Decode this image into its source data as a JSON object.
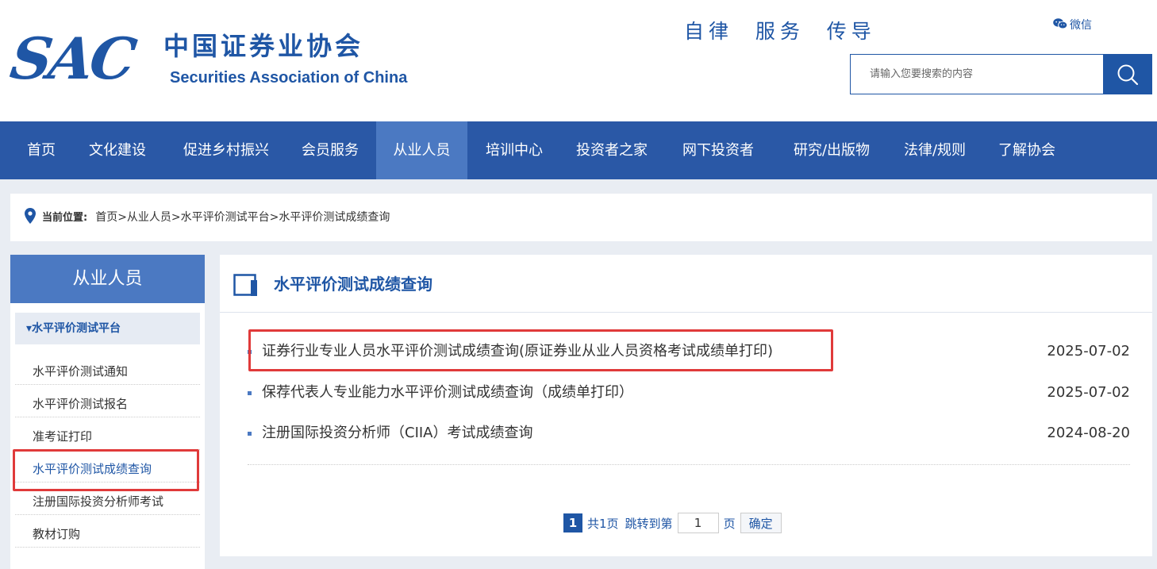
{
  "header": {
    "logo_mark": "SAC",
    "logo_cn": "中国证券业协会",
    "logo_en": "Securities Association of China",
    "slogan": "自律  服务  传导",
    "wechat_label": "微信",
    "search_placeholder": "请输入您要搜索的内容"
  },
  "nav": {
    "items": [
      {
        "label": "首页"
      },
      {
        "label": "文化建设"
      },
      {
        "label": "促进乡村振兴"
      },
      {
        "label": "会员服务"
      },
      {
        "label": "从业人员"
      },
      {
        "label": "培训中心"
      },
      {
        "label": "投资者之家"
      },
      {
        "label": "网下投资者"
      },
      {
        "label": "研究/出版物"
      },
      {
        "label": "法律/规则"
      },
      {
        "label": "了解协会"
      }
    ],
    "active": "从业人员"
  },
  "breadcrumb": {
    "label": "当前位置:",
    "path": "首页>从业人员>水平评价测试平台>水平评价测试成绩查询"
  },
  "sidebar": {
    "title": "从业人员",
    "group": "▾水平评价测试平台",
    "items": [
      {
        "label": "水平评价测试通知"
      },
      {
        "label": "水平评价测试报名"
      },
      {
        "label": "准考证打印"
      },
      {
        "label": "水平评价测试成绩查询"
      },
      {
        "label": "注册国际投资分析师考试"
      },
      {
        "label": "教材订购"
      }
    ]
  },
  "main": {
    "title": "水平评价测试成绩查询",
    "rows": [
      {
        "title": "证券行业专业人员水平评价测试成绩查询(原证券业从业人员资格考试成绩单打印)",
        "date": "2025-07-02"
      },
      {
        "title": "保荐代表人专业能力水平评价测试成绩查询（成绩单打印）",
        "date": "2025-07-02"
      },
      {
        "title": "注册国际投资分析师（CIIA）考试成绩查询",
        "date": "2024-08-20"
      }
    ],
    "pager": {
      "current": "1",
      "total_text": "共1页",
      "jump_text": "跳转到第",
      "page_value": "1",
      "page_unit": "页",
      "confirm": "确定"
    }
  },
  "colors": {
    "brand": "#1f56a5",
    "nav_bg": "#2a58a6",
    "nav_active": "#4b79c2",
    "highlight": "#e03a3a"
  }
}
